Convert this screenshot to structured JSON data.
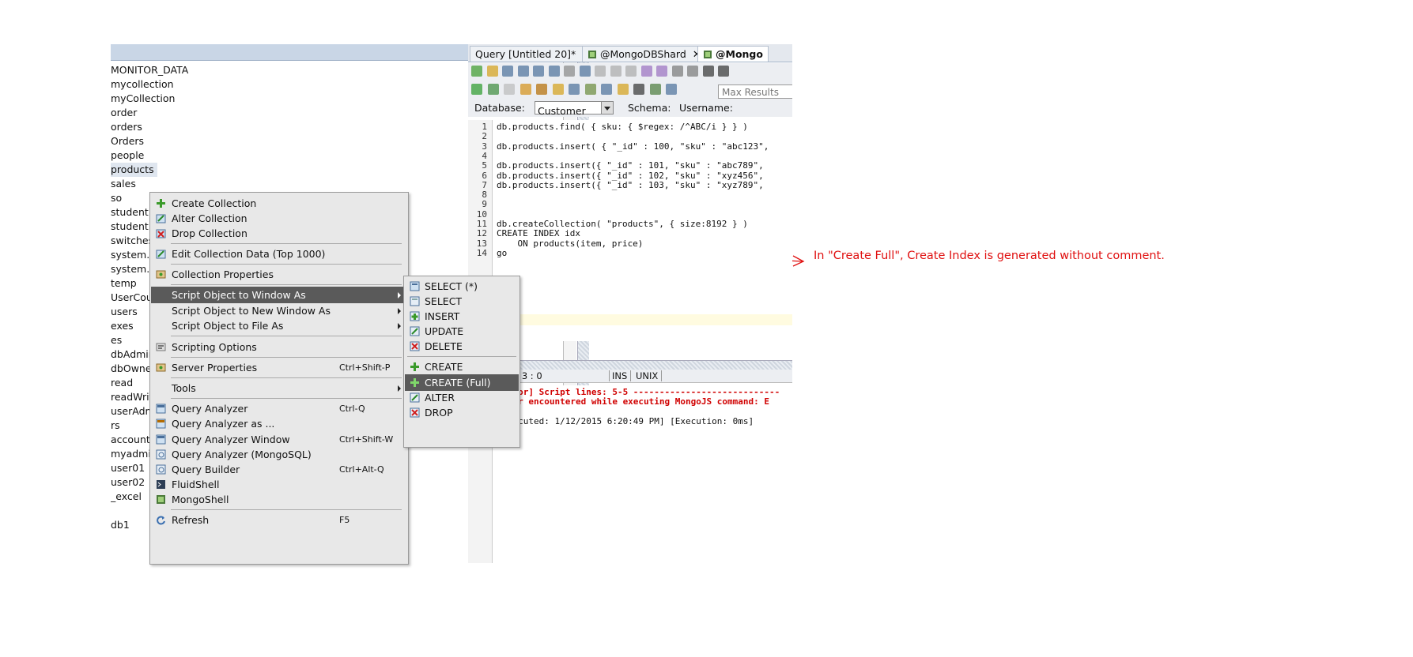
{
  "tree": {
    "items": [
      "MONITOR_DATA",
      "mycollection",
      "myCollection",
      "order",
      "orders",
      "Orders",
      "people",
      "products",
      "sales",
      "so",
      "student",
      "student",
      "switches",
      "system.i",
      "system.p",
      "temp",
      "UserCou",
      "users",
      "exes",
      "es",
      "dbAdmir",
      "dbOwne",
      "read",
      "readWrit",
      "userAdm",
      "rs",
      "account",
      "myadmir",
      "user01",
      "user02",
      "_excel",
      "",
      "db1"
    ]
  },
  "tabs": [
    {
      "label": "Query [Untitled 20]*"
    },
    {
      "label": "@MongoDBShard"
    },
    {
      "label": "@Mongo"
    }
  ],
  "toolbar": {
    "max_results_placeholder": "Max Results"
  },
  "dbrow": {
    "database_label": "Database:",
    "database_value": "Customer",
    "schema_label": "Schema:",
    "username_label": "Username:"
  },
  "editor": {
    "lines": [
      "db.products.find( { sku: { $regex: /^ABC/i } } )",
      "",
      "db.products.insert( { \"_id\" : 100, \"sku\" : \"abc123\",",
      "",
      "db.products.insert({ \"_id\" : 101, \"sku\" : \"abc789\",",
      "db.products.insert({ \"_id\" : 102, \"sku\" : \"xyz456\",",
      "db.products.insert({ \"_id\" : 103, \"sku\" : \"xyz789\",",
      "",
      "",
      "",
      "db.createCollection( \"products\", { size:8192 } )",
      "CREATE INDEX idx",
      "    ON products(item, price)",
      "go"
    ]
  },
  "status": {
    "position": "14 | 3 : 0",
    "mode": "INS",
    "eol": "UNIX"
  },
  "output": {
    "lines": [
      ">[Error] Script lines: 5-5 ----------------------------",
      " Error encountered while executing MongoJS command: E",
      "",
      " [Executed: 1/12/2015 6:20:49 PM] [Execution: 0ms]",
      "",
      ""
    ]
  },
  "menu": {
    "create_collection": "Create Collection",
    "alter_collection": "Alter Collection",
    "drop_collection": "Drop Collection",
    "edit_collection_data": "Edit Collection Data (Top 1000)",
    "collection_properties": "Collection Properties",
    "script_to_window": "Script Object to Window As",
    "script_to_new_window": "Script Object to New Window As",
    "script_to_file": "Script Object to File As",
    "scripting_options": "Scripting Options",
    "server_properties": "Server Properties",
    "server_properties_shortcut": "Ctrl+Shift-P",
    "tools": "Tools",
    "query_analyzer": "Query Analyzer",
    "query_analyzer_shortcut": "Ctrl-Q",
    "query_analyzer_as": "Query Analyzer as ...",
    "query_analyzer_window": "Query Analyzer Window",
    "query_analyzer_window_shortcut": "Ctrl+Shift-W",
    "query_analyzer_mongosql": "Query Analyzer (MongoSQL)",
    "query_builder": "Query Builder",
    "query_builder_shortcut": "Ctrl+Alt-Q",
    "fluidshell": "FluidShell",
    "mongoshell": "MongoShell",
    "refresh": "Refresh",
    "refresh_shortcut": "F5"
  },
  "submenu": {
    "select_star": "SELECT (*)",
    "select": "SELECT",
    "insert": "INSERT",
    "update": "UPDATE",
    "delete": "DELETE",
    "create": "CREATE",
    "create_full": "CREATE (Full)",
    "alter": "ALTER",
    "drop": "DROP"
  },
  "annotation": {
    "text": "In \"Create Full\", Create Index is generated without comment.",
    "color": "#e01010"
  }
}
